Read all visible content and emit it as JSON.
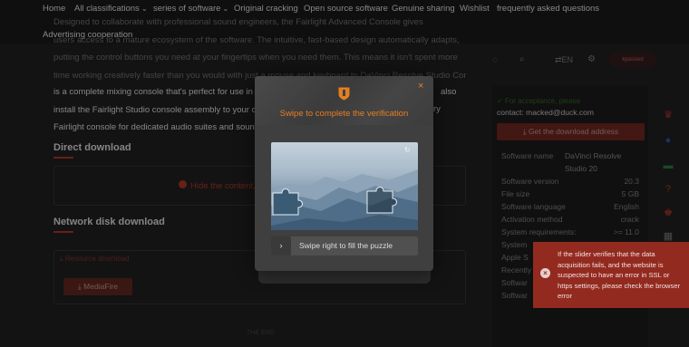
{
  "nav": {
    "items": [
      "Home",
      "All classifications",
      "series of software",
      "Original cracking",
      "Open source software",
      "Genuine sharing",
      "Wishlist",
      "frequently asked questions",
      "Advertising cooperation"
    ],
    "dropdown_arrow": "⌄"
  },
  "article": {
    "dim_lines": [
      "Designed to collaborate with professional sound engineers, the Fairlight Advanced Console gives",
      "users access to a mature ecosystem of the software. The intuitive, fast-based design automatically adapts,",
      "putting the control buttons you need at your fingertips when you need them. This means it isn't spent more",
      "time working creatively faster than you would with just a mouse and keyboard to DaVinci Resolve Studio Console"
    ],
    "bright_lines": [
      "is a complete mixing console that's perfect for use in",
      "install the Fairlight Studio console assembly to your ov",
      "Fairlight console for dedicated audio suites and sound"
    ],
    "bright_right_1": "also",
    "bright_right_2": "ry"
  },
  "sections": {
    "direct": "Direct download",
    "hide_text": "Hide the content,",
    "netdisk": "Network disk download",
    "resource": "Resource download",
    "mediafire": "MediaFire",
    "theend": "THE END"
  },
  "header": {
    "lang": "EN",
    "avatar": "kpasswd"
  },
  "sidebar": {
    "contact_label": "For acceptance, please",
    "contact": "contact: macked@duck.com",
    "download_btn": "Get the download address",
    "specs": [
      {
        "k": "Software name",
        "v": "DaVinci Resolve"
      },
      {
        "k": "",
        "v": "Studio 20"
      },
      {
        "k": "Software version",
        "v": "20.3"
      },
      {
        "k": "File size",
        "v": "5 GB"
      },
      {
        "k": "Software language",
        "v": "English"
      },
      {
        "k": "Activation method",
        "v": "crack"
      },
      {
        "k": "System requirements:",
        "v": ">= 11.0"
      },
      {
        "k": "System",
        "v": ""
      },
      {
        "k": "Apple S",
        "v": ""
      },
      {
        "k": "Recently",
        "v": ""
      },
      {
        "k": "Softwar",
        "v": ""
      },
      {
        "k": "Softwar",
        "v": ""
      }
    ]
  },
  "modal": {
    "title": "Swipe to complete the verification",
    "close": "×",
    "refresh": "↻",
    "slider_handle": "›",
    "slider_text": "Swipe right to fill the puzzle"
  },
  "toast": {
    "icon": "×",
    "message": "If the slider verifies that the data acquisition fails, and the website is suspected to have an error in SSL or https settings, please check the browser error"
  },
  "colors": {
    "accent": "#e67e22",
    "danger": "#932a20"
  }
}
